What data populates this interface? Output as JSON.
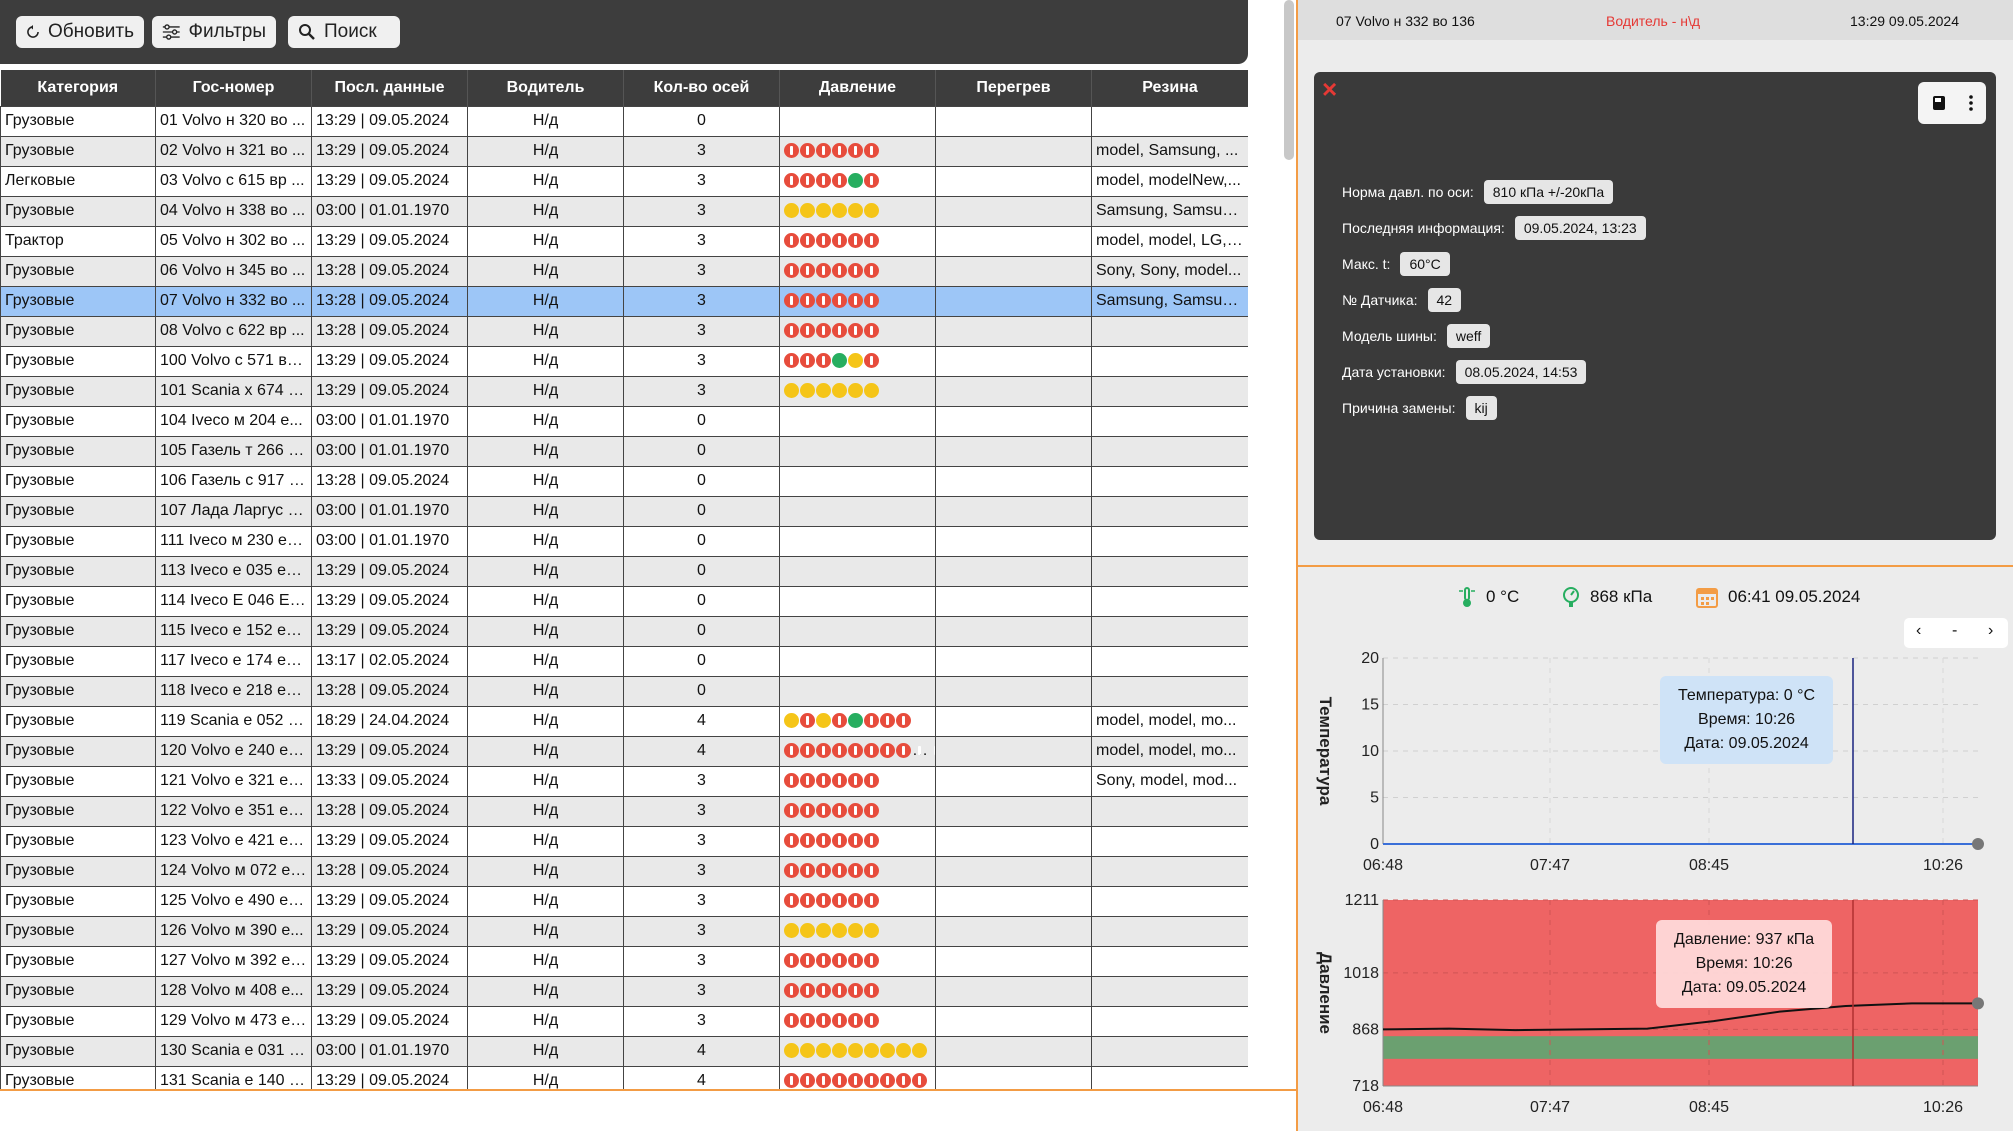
{
  "toolbar": {
    "refresh": "Обновить",
    "filters": "Фильтры",
    "search": "Поиск"
  },
  "table": {
    "headers": [
      "Категория",
      "Гос-номер",
      "Посл. данные",
      "Водитель",
      "Кол-во осей",
      "Давление",
      "Перегрев",
      "Резина"
    ],
    "rows": [
      [
        "Грузовые",
        "01 Volvo н 320 во ...",
        "13:29 | 09.05.2024",
        "Н/д",
        "0",
        "",
        "",
        ""
      ],
      [
        "Грузовые",
        "02 Volvo н 321 во ...",
        "13:29 | 09.05.2024",
        "Н/д",
        "3",
        "rrrrrr",
        "",
        "model, Samsung, ..."
      ],
      [
        "Легковые",
        "03 Volvo с 615 вр ...",
        "13:29 | 09.05.2024",
        "Н/д",
        "3",
        "rrrrgr",
        "",
        "model, modelNew,..."
      ],
      [
        "Грузовые",
        "04 Volvo н 338 во ...",
        "03:00 | 01.01.1970",
        "Н/д",
        "3",
        "yyyyyy",
        "",
        "Samsung, Samsun..."
      ],
      [
        "Трактор",
        "05 Volvo н 302 во ...",
        "13:29 | 09.05.2024",
        "Н/д",
        "3",
        "rrrrrr",
        "",
        "model, model, LG, ..."
      ],
      [
        "Грузовые",
        "06 Volvo н 345 во ...",
        "13:28 | 09.05.2024",
        "Н/д",
        "3",
        "rrrrrr",
        "",
        "Sony, Sony, model..."
      ],
      [
        "Грузовые",
        "07 Volvo н 332 во ...",
        "13:28 | 09.05.2024",
        "Н/д",
        "3",
        "rrrrrr",
        "",
        "Samsung, Samsun..."
      ],
      [
        "Грузовые",
        "08 Volvo с 622 вр ...",
        "13:28 | 09.05.2024",
        "Н/д",
        "3",
        "rrrrrr",
        "",
        ""
      ],
      [
        "Грузовые",
        "100 Volvo с 571 вх ...",
        "13:29 | 09.05.2024",
        "Н/д",
        "3",
        "rrrgyr",
        "",
        ""
      ],
      [
        "Грузовые",
        "101 Scania х 674 е...",
        "13:29 | 09.05.2024",
        "Н/д",
        "3",
        "yyyyyy",
        "",
        ""
      ],
      [
        "Грузовые",
        "104 Iveco м 204 е...",
        "03:00 | 01.01.1970",
        "Н/д",
        "0",
        "",
        "",
        ""
      ],
      [
        "Грузовые",
        "105 Газель т 266 у...",
        "03:00 | 01.01.1970",
        "Н/д",
        "0",
        "",
        "",
        ""
      ],
      [
        "Грузовые",
        "106 Газель с 917 в...",
        "13:28 | 09.05.2024",
        "Н/д",
        "0",
        "",
        "",
        ""
      ],
      [
        "Грузовые",
        "107 Лада Ларгус с...",
        "03:00 | 01.01.1970",
        "Н/д",
        "0",
        "",
        "",
        ""
      ],
      [
        "Грузовые",
        "111 Iveco м 230 ес ...",
        "03:00 | 01.01.1970",
        "Н/д",
        "0",
        "",
        "",
        ""
      ],
      [
        "Грузовые",
        "113 Iveco е 035 ес ...",
        "13:29 | 09.05.2024",
        "Н/д",
        "0",
        "",
        "",
        ""
      ],
      [
        "Грузовые",
        "114 Iveco Е 046 ЕС...",
        "13:29 | 09.05.2024",
        "Н/д",
        "0",
        "",
        "",
        ""
      ],
      [
        "Грузовые",
        "115 Iveco е 152 ес ...",
        "13:29 | 09.05.2024",
        "Н/д",
        "0",
        "",
        "",
        ""
      ],
      [
        "Грузовые",
        "117 Iveco е 174 ес ...",
        "13:17 | 02.05.2024",
        "Н/д",
        "0",
        "",
        "",
        ""
      ],
      [
        "Грузовые",
        "118 Iveco е 218 ес ...",
        "13:28 | 09.05.2024",
        "Н/д",
        "0",
        "",
        "",
        ""
      ],
      [
        "Грузовые",
        "119 Scania е 052 е...",
        "18:29 | 24.04.2024",
        "Н/д",
        "4",
        "yryrgrrr",
        "",
        "model, model, mo..."
      ],
      [
        "Грузовые",
        "120 Volvo е 240 ес...",
        "13:29 | 09.05.2024",
        "Н/д",
        "4",
        "rrrrrrrrrr",
        "",
        "model, model, mo..."
      ],
      [
        "Грузовые",
        "121 Volvo е 321 ес ...",
        "13:33 | 09.05.2024",
        "Н/д",
        "3",
        "rrrrrr",
        "",
        "Sony, model, mod..."
      ],
      [
        "Грузовые",
        "122 Volvo е 351 ес ...",
        "13:28 | 09.05.2024",
        "Н/д",
        "3",
        "rrrrrr",
        "",
        ""
      ],
      [
        "Грузовые",
        "123 Volvo е 421 ес ...",
        "13:29 | 09.05.2024",
        "Н/д",
        "3",
        "rrrrrr",
        "",
        ""
      ],
      [
        "Грузовые",
        "124 Volvo м 072 ес...",
        "13:28 | 09.05.2024",
        "Н/д",
        "3",
        "rrrrrr",
        "",
        ""
      ],
      [
        "Грузовые",
        "125 Volvo е 490 ес...",
        "13:29 | 09.05.2024",
        "Н/д",
        "3",
        "rrrrrr",
        "",
        ""
      ],
      [
        "Грузовые",
        "126 Volvo м 390 е...",
        "13:29 | 09.05.2024",
        "Н/д",
        "3",
        "yyyyyy",
        "",
        ""
      ],
      [
        "Грузовые",
        "127 Volvo м 392 ес...",
        "13:29 | 09.05.2024",
        "Н/д",
        "3",
        "rrrrrr",
        "",
        ""
      ],
      [
        "Грузовые",
        "128 Volvo м 408 е...",
        "13:29 | 09.05.2024",
        "Н/д",
        "3",
        "rrrrrr",
        "",
        ""
      ],
      [
        "Грузовые",
        "129 Volvo м 473 ес...",
        "13:29 | 09.05.2024",
        "Н/д",
        "3",
        "rrrrrr",
        "",
        ""
      ],
      [
        "Грузовые",
        "130 Scania е 031 е...",
        "03:00 | 01.01.1970",
        "Н/д",
        "4",
        "yyyyyyyyy",
        "",
        ""
      ],
      [
        "Грузовые",
        "131 Scania е 140 е...",
        "13:29 | 09.05.2024",
        "Н/д",
        "4",
        "rrrrrrrrr",
        "",
        ""
      ]
    ],
    "selected_index": 6
  },
  "header": {
    "vehicle": "07 Volvo н 332 во 136",
    "driver": "Водитель - н\\д",
    "datetime": "13:29 09.05.2024"
  },
  "info": {
    "fields": [
      {
        "label": "Норма давл. по оси:",
        "value": "810 кПа +/-20кПа"
      },
      {
        "label": "Последняя информация:",
        "value": "09.05.2024, 13:23"
      },
      {
        "label": "Макс. t:",
        "value": "60°C"
      },
      {
        "label": "№ Датчика:",
        "value": "42"
      },
      {
        "label": "Модель шины:",
        "value": "weff"
      },
      {
        "label": "Дата установки:",
        "value": "08.05.2024, 14:53"
      },
      {
        "label": "Причина замены:",
        "value": "kij"
      }
    ]
  },
  "sensors": {
    "temperature": "0 °C",
    "pressure": "868 кПа",
    "datetime": "06:41 09.05.2024"
  },
  "nav": {
    "prev": "‹",
    "mid": "-",
    "next": "›"
  },
  "colors": {
    "accent": "#f39c45",
    "selected_row": "#9dc6f7",
    "pressure_red": "#e74c3c",
    "pressure_yellow": "#f5c518",
    "pressure_green": "#27ae60",
    "chart_red_zone": "#ee6464",
    "chart_green_zone": "#6ba070"
  },
  "chart_data": [
    {
      "type": "line",
      "ylabel": "Температура",
      "x": [
        "06:48",
        "07:47",
        "08:45",
        "10:26"
      ],
      "yticks": [
        0,
        5,
        10,
        15,
        20
      ],
      "ylim": [
        0,
        20
      ],
      "series": [
        {
          "values": [
            0,
            0,
            0,
            0
          ]
        }
      ],
      "tooltip": [
        "Температура: 0 °C",
        "Время: 10:26",
        "Дата: 09.05.2024"
      ]
    },
    {
      "type": "line",
      "ylabel": "Давление",
      "x": [
        "06:48",
        "07:47",
        "08:45",
        "10:26"
      ],
      "yticks": [
        718,
        868,
        1018,
        1211
      ],
      "ylim": [
        718,
        1211
      ],
      "series": [
        {
          "values": [
            868,
            870,
            866,
            868,
            870,
            890,
            915,
            930,
            937,
            937
          ]
        }
      ],
      "tooltip": [
        "Давление: 937 кПа",
        "Время: 10:26",
        "Дата: 09.05.2024"
      ]
    }
  ]
}
